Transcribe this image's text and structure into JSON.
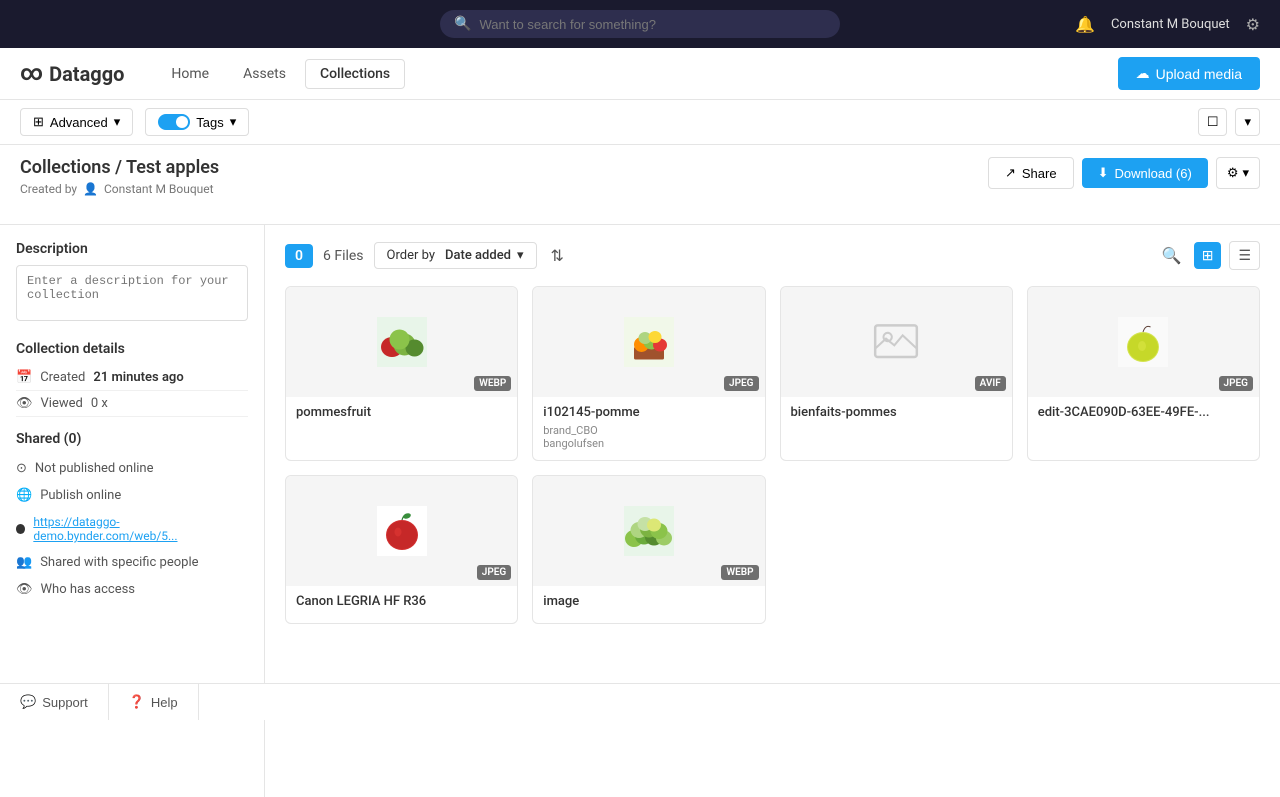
{
  "topbar": {
    "search_placeholder": "Want to search for something?",
    "username": "Constant M Bouquet"
  },
  "mainnav": {
    "logo_text": "Dataggo",
    "links": [
      {
        "label": "Home",
        "active": false
      },
      {
        "label": "Assets",
        "active": false
      },
      {
        "label": "Collections",
        "active": true
      }
    ],
    "upload_label": "Upload media"
  },
  "toolbar": {
    "advanced_label": "Advanced",
    "tags_label": "Tags"
  },
  "page": {
    "breadcrumb": "Collections / Test apples",
    "created_by_label": "Created by",
    "author": "Constant M Bouquet",
    "share_label": "Share",
    "download_label": "Download (6)"
  },
  "sidebar": {
    "description_section": "Description",
    "description_placeholder": "Enter a description for your collection",
    "details_section": "Collection details",
    "created_label": "Created",
    "created_value": "21 minutes ago",
    "viewed_label": "Viewed",
    "viewed_value": "0 x",
    "shared_section": "Shared (0)",
    "not_published": "Not published online",
    "publish_online": "Publish online",
    "share_link": "https://dataggo-demo.bynder.com/web/5...",
    "shared_people": "Shared with specific people",
    "who_access": "Who has access"
  },
  "filter_bar": {
    "badge": "0",
    "files_label": "6 Files",
    "order_label": "Order by",
    "order_value": "Date added"
  },
  "media_items": [
    {
      "name": "pommesfruit",
      "format": "WEBP",
      "tag1": "",
      "tag2": "",
      "color": "#7ab648",
      "type": "apple_green"
    },
    {
      "name": "i102145-pomme",
      "format": "JPEG",
      "tag1": "brand_CBO",
      "tag2": "bangolufsen",
      "color": "#8bc34a",
      "type": "apple_basket"
    },
    {
      "name": "bienfaits-pommes",
      "format": "AVIF",
      "tag1": "",
      "tag2": "",
      "color": "#f0f0f0",
      "type": "placeholder"
    },
    {
      "name": "edit-3CAE090D-63EE-49FE-...",
      "format": "JPEG",
      "tag1": "",
      "tag2": "",
      "color": "#d4e44f",
      "type": "apple_yellow"
    },
    {
      "name": "Canon LEGRIA HF R36",
      "format": "JPEG",
      "tag1": "",
      "tag2": "",
      "color": "#cc3333",
      "type": "apple_red"
    },
    {
      "name": "image",
      "format": "WEBP",
      "tag1": "",
      "tag2": "",
      "color": "#6aab3c",
      "type": "apple_pile"
    }
  ],
  "footer": {
    "support_label": "Support",
    "help_label": "Help"
  }
}
